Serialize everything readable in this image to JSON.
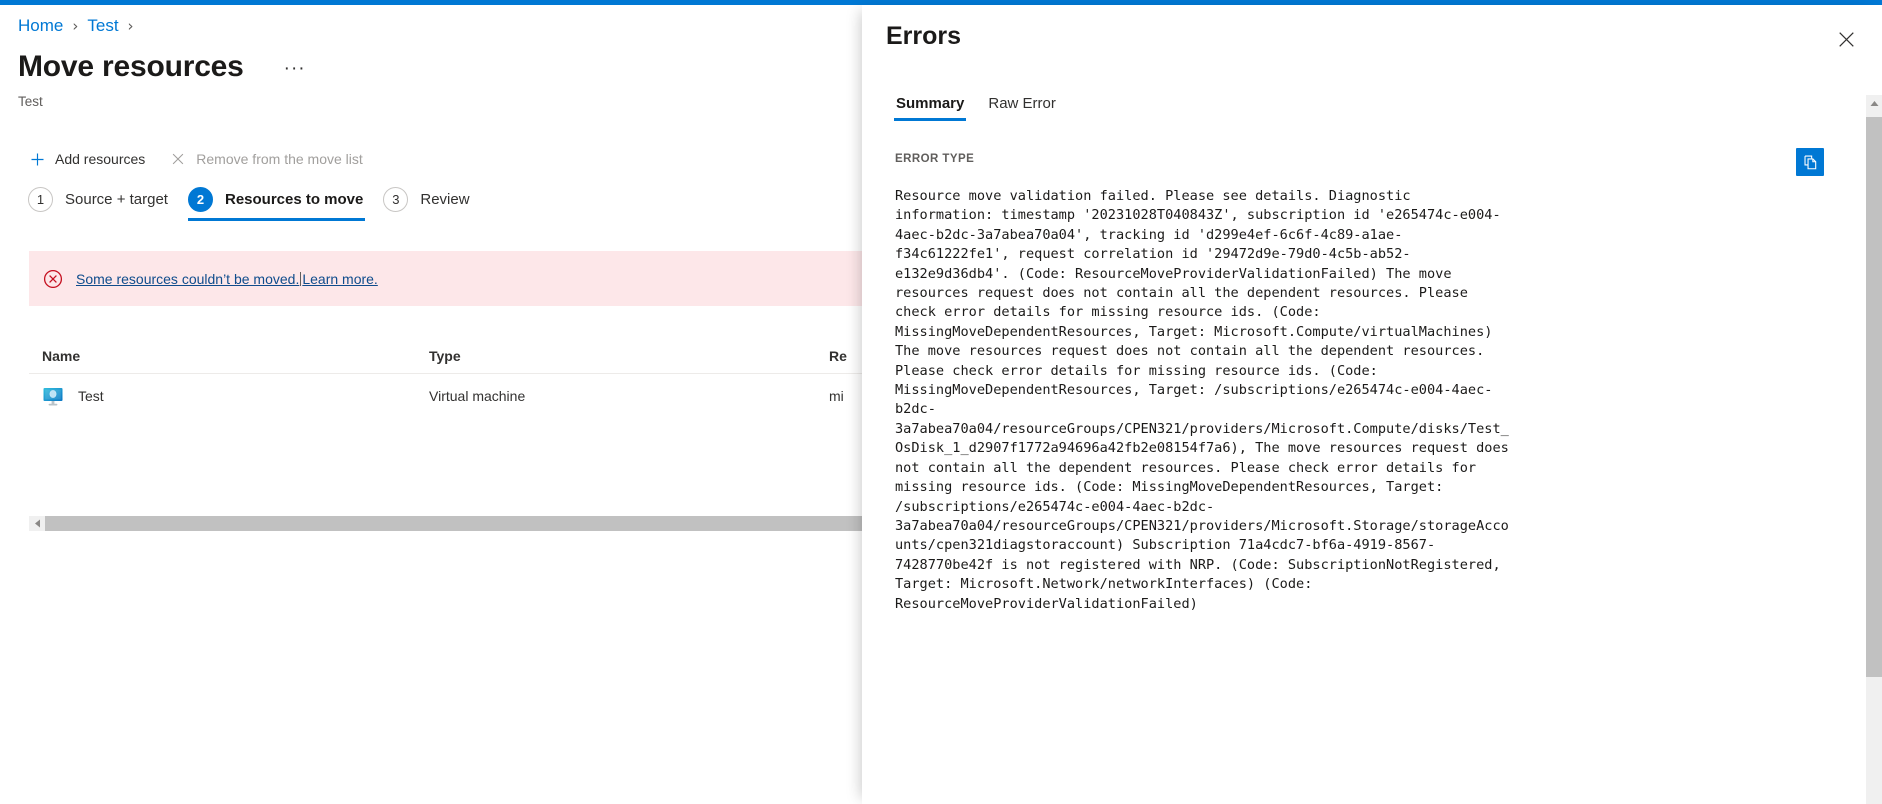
{
  "breadcrumb": {
    "items": [
      {
        "label": "Home"
      },
      {
        "label": "Test"
      }
    ],
    "separator": "›"
  },
  "header": {
    "title": "Move resources",
    "subtitle": "Test",
    "more_label": "···"
  },
  "command_bar": {
    "add_resources": "Add resources",
    "remove_from_move_list": "Remove from the move list"
  },
  "wizard": {
    "steps": [
      {
        "number": "1",
        "label": "Source + target",
        "active": false
      },
      {
        "number": "2",
        "label": "Resources to move",
        "active": true
      },
      {
        "number": "3",
        "label": "Review",
        "active": false
      }
    ]
  },
  "banner": {
    "message": "Some resources couldn’t be moved.",
    "link": "Learn more.",
    "background": "#fde7e9",
    "icon_color": "#c50f1f"
  },
  "table": {
    "columns": [
      {
        "key": "name",
        "label": "Name"
      },
      {
        "key": "type",
        "label": "Type"
      },
      {
        "key": "resource",
        "label": "Re"
      }
    ],
    "rows": [
      {
        "name": "Test",
        "type": "Virtual machine",
        "resource": "mi",
        "icon": "virtual-machine-icon"
      }
    ]
  },
  "panel": {
    "title": "Errors",
    "close_label": "✕",
    "tabs": [
      {
        "label": "Summary",
        "active": true
      },
      {
        "label": "Raw Error",
        "active": false
      }
    ],
    "error_type_label": "ERROR TYPE",
    "copy_button_label": "Copy to clipboard",
    "copy_button_color": "#0078d4",
    "error_text": "Resource move validation failed. Please see details. Diagnostic information: timestamp '20231028T040843Z', subscription id 'e265474c-e004-4aec-b2dc-3a7abea70a04', tracking id 'd299e4ef-6c6f-4c89-a1ae-f34c61222fe1', request correlation id '29472d9e-79d0-4c5b-ab52-e132e9d36db4'. (Code: ResourceMoveProviderValidationFailed) The move resources request does not contain all the dependent resources. Please check error details for missing resource ids. (Code: MissingMoveDependentResources, Target: Microsoft.Compute/virtualMachines) The move resources request does not contain all the dependent resources. Please check error details for missing resource ids. (Code: MissingMoveDependentResources, Target: /subscriptions/e265474c-e004-4aec-b2dc-3a7abea70a04/resourceGroups/CPEN321/providers/Microsoft.Compute/disks/Test_OsDisk_1_d2907f1772a94696a42fb2e08154f7a6), The move resources request does not contain all the dependent resources. Please check error details for missing resource ids. (Code: MissingMoveDependentResources, Target: /subscriptions/e265474c-e004-4aec-b2dc-3a7abea70a04/resourceGroups/CPEN321/providers/Microsoft.Storage/storageAccounts/cpen321diagstoraccount) Subscription 71a4cdc7-bf6a-4919-8567-7428770be42f is not registered with NRP. (Code: SubscriptionNotRegistered, Target: Microsoft.Network/networkInterfaces) (Code: ResourceMoveProviderValidationFailed)"
  },
  "theme": {
    "accent": "#0078d4",
    "link": "#0078d4",
    "text": "#323130",
    "muted": "#605e5c"
  }
}
